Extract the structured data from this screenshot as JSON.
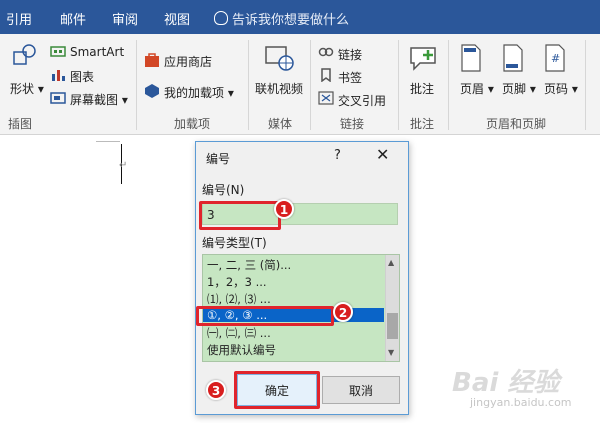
{
  "tabs": [
    "引用",
    "邮件",
    "审阅",
    "视图"
  ],
  "tell_me": "告诉我你想要做什么",
  "ribbon": {
    "shapes": "形状",
    "smartart": "SmartArt",
    "chart": "图表",
    "screenshot": "屏幕截图",
    "store": "应用商店",
    "my_addins": "我的加载项",
    "online_video": "联机视频",
    "link": "链接",
    "bookmark": "书签",
    "cross_ref": "交叉引用",
    "comment": "批注",
    "header": "页眉",
    "footer": "页脚",
    "page_number": "页码",
    "groups": {
      "illustrations": "插图",
      "addins": "加载项",
      "media": "媒体",
      "links": "链接",
      "comments": "批注",
      "header_footer": "页眉和页脚"
    }
  },
  "dialog": {
    "title": "编号",
    "help": "?",
    "close": "✕",
    "number_label": "编号(N)",
    "number_value": "3",
    "type_label": "编号类型(T)",
    "types": [
      "一, 二, 三 (简)...",
      "1，2，3 ...",
      "⑴, ⑵, ⑶ ...",
      "①, ②, ③ ...",
      "㈠, ㈡, ㈢ ...",
      "使用默认编号"
    ],
    "selected_type": "①, ②, ③ ...",
    "ok": "确定",
    "cancel": "取消"
  },
  "annotations": [
    "1",
    "2",
    "3"
  ],
  "watermark": {
    "logo": "Bai 经验",
    "url": "jingyan.baidu.com"
  },
  "colors": {
    "ribbon_tab": "#2b579a",
    "highlight": "#e0242c",
    "selection": "#0a64c8",
    "list_bg": "#c6e6c2"
  }
}
